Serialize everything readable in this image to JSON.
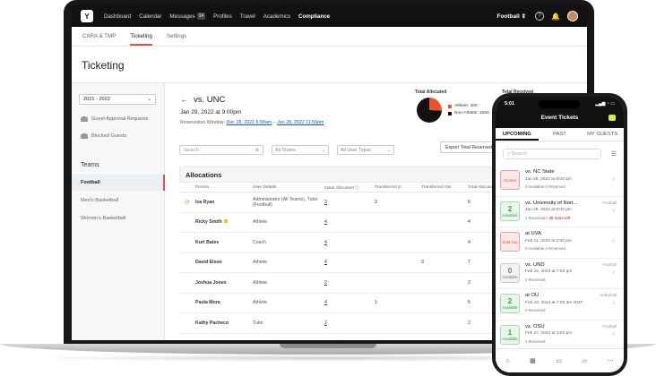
{
  "nav": {
    "logo": "Y",
    "items": [
      "Dashboard",
      "Calendar",
      "Messages",
      "Profiles",
      "Travel",
      "Academics",
      "Compliance"
    ],
    "messages_badge": "14",
    "sport": "Football",
    "help_icon": "?"
  },
  "subtabs": [
    "CARA & TMP",
    "Ticketing",
    "Settings"
  ],
  "page_title": "Ticketing",
  "sidebar": {
    "season": "2021 - 2022",
    "links": [
      "Guest Approval Requests",
      "Blocked Guests"
    ],
    "teams_heading": "Teams",
    "teams": [
      "Football",
      "Men's Basketball",
      "Women's Basketball"
    ]
  },
  "game": {
    "title": "vs. UNC",
    "date": "Jan 29, 2022 at 9:00pm",
    "window_label": "Reservation Window:",
    "window_start": "Dec 28, 2021 6:00am",
    "window_sep": "–",
    "window_end": "Jan 28, 2022 11:59pm"
  },
  "allocated": {
    "label": "Total Allocated",
    "athlete": "Athlete: 400",
    "non_athlete": "Non-Athlete: 1050",
    "received_label": "Total Received",
    "colors": {
      "athlete": "#e8552a",
      "non_athlete": "#111111"
    },
    "athlete_fraction": 0.26
  },
  "filters": {
    "search_placeholder": "Search",
    "teams": "All Teams",
    "user_types": "All User Types",
    "export": "Export Total Reserved"
  },
  "table": {
    "title": "Allocations",
    "headers": [
      "Person",
      "User Details",
      "Initial Allocation",
      "Transferred In",
      "Transferred Out",
      "Total Allocated"
    ],
    "rows": [
      {
        "person": "Iva Ryan",
        "details": "Administrator (All Teams), Tutor (Football)",
        "initial": "3",
        "in": "3",
        "out": "",
        "total": "6"
      },
      {
        "person": "Ricky Smith",
        "details": "Athlete",
        "initial": "4",
        "in": "",
        "out": "",
        "total": "4"
      },
      {
        "person": "Kurt Bates",
        "details": "Coach",
        "initial": "4",
        "in": "",
        "out": "",
        "total": "4"
      },
      {
        "person": "David Elson",
        "details": "Athlete",
        "initial": "4",
        "in": "",
        "out": "3",
        "total": "7"
      },
      {
        "person": "Joshua Jones",
        "details": "Athlete",
        "initial": "2",
        "in": "",
        "out": "",
        "total": "2"
      },
      {
        "person": "Paula Mora",
        "details": "Athlete",
        "initial": "4",
        "in": "1",
        "out": "",
        "total": "5"
      },
      {
        "person": "Kathy Pacheco",
        "details": "Tutor",
        "initial": "2",
        "in": "",
        "out": "",
        "total": "2"
      }
    ]
  },
  "phone": {
    "time": "5:01",
    "status": "▂▄▆ ◔ ▭",
    "title": "Event Tickets",
    "tabs": [
      "UPCOMING",
      "PAST",
      "MY GUESTS"
    ],
    "search_placeholder": "Search",
    "events": [
      {
        "status": "Closed",
        "num": "",
        "name": "vs. NC State",
        "date": "Jan 28, 2022 at 8:00 am",
        "meta": "3 Available   0 Reserved",
        "sport": "",
        "extra": ""
      },
      {
        "status": "Available",
        "num": "2",
        "name": "vs. University of Nort...",
        "date": "Jan 29, 2022 at 9:00 pm",
        "meta": "1 Reserved",
        "sport": "Football",
        "extra": "30 mins left"
      },
      {
        "status": "Sold Out",
        "num": "",
        "name": "at UVA",
        "date": "Feb 11, 2022 at 2:00 pm",
        "meta": "0 Available   2 Reserved",
        "sport": "",
        "extra": ""
      },
      {
        "status": "Available",
        "num": "0",
        "name": "vs. UND",
        "date": "Feb 15, 2022 at 7:00 pm",
        "meta": "1 Reserved",
        "sport": "Football",
        "extra": ""
      },
      {
        "status": "Available",
        "num": "2",
        "name": "at OU",
        "date": "Feb 19, 2022 at 7:00 am GMT",
        "meta": "0 Reserved",
        "sport": "Volleyball",
        "extra": ""
      },
      {
        "status": "Available",
        "num": "1",
        "name": "vs. OSU",
        "date": "Feb 27, 2022 at 3:00 pm",
        "meta": "1 Reserved",
        "sport": "Football",
        "extra": ""
      }
    ]
  }
}
